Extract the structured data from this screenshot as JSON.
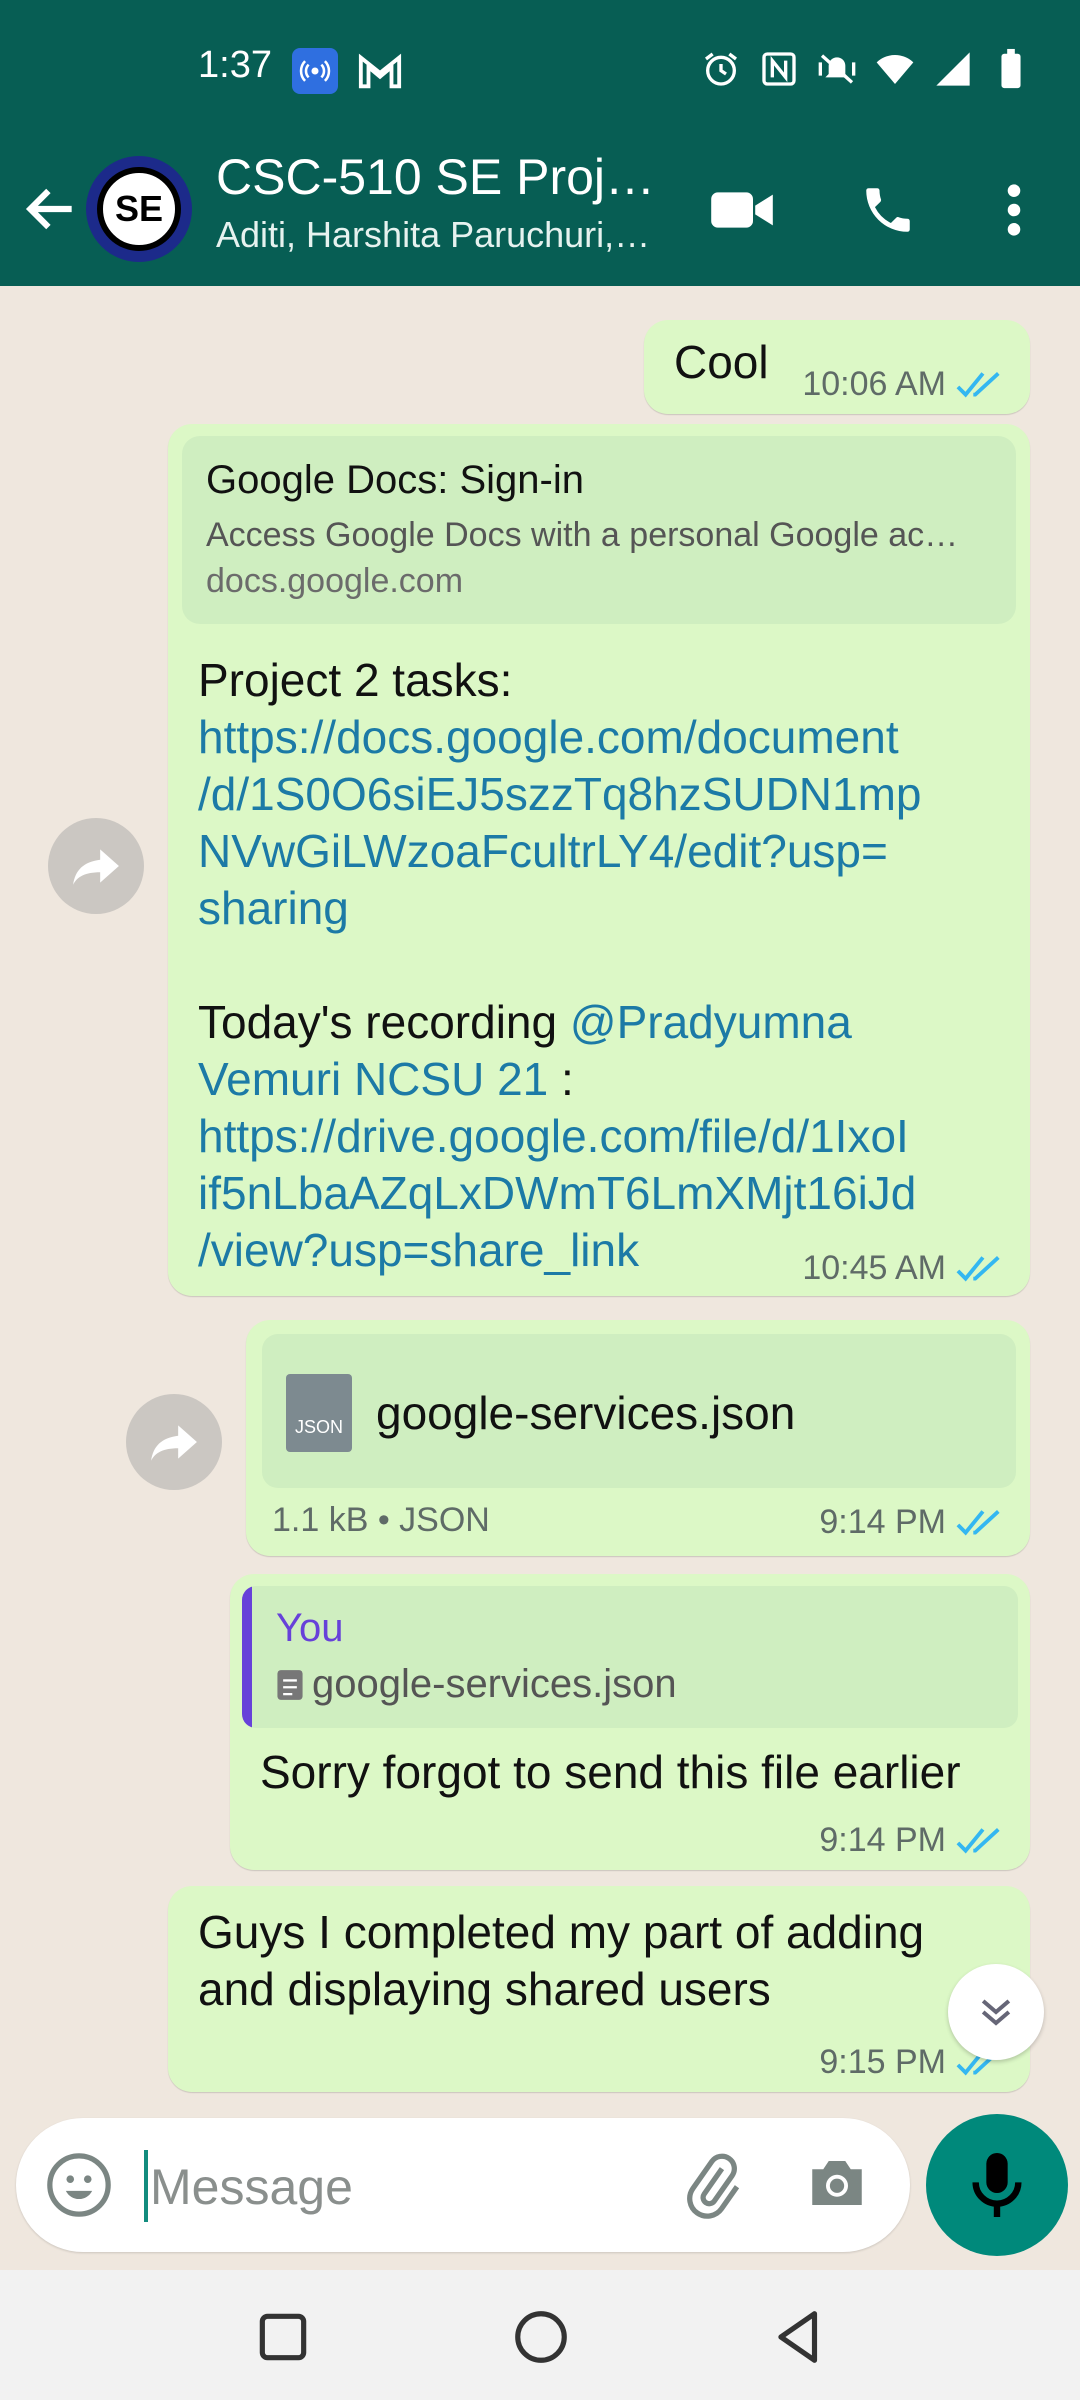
{
  "status_bar": {
    "time": "1:37",
    "icons": [
      "hotspot-icon",
      "gmail-icon",
      "alarm-icon",
      "nfc-icon",
      "vibrate-icon",
      "wifi-icon",
      "signal-icon",
      "battery-icon"
    ]
  },
  "header": {
    "avatar_text": "SE",
    "title": "CSC-510 SE Proj…",
    "subtitle": "Aditi, Harshita Paruchuri,…"
  },
  "messages": {
    "m1": {
      "text": "Cool",
      "time": "10:06 AM"
    },
    "m2": {
      "preview_title": "Google Docs: Sign-in",
      "preview_desc": "Access Google Docs with a personal Google ac…",
      "preview_domain": "docs.google.com",
      "line1": "Project 2 tasks:",
      "link1a": "https://docs.google.com/document",
      "link1b": "/d/1S0O6siEJ5szzTq8hzSUDN1mp",
      "link1c": "NVwGiLWzoaFcultrLY4/edit?usp=",
      "link1d": "sharing",
      "line2_prefix": "Today's recording ",
      "mention_a": "@Pradyumna",
      "mention_b": "Vemuri NCSU 21",
      "line2_suffix": " :",
      "link2a": "https://drive.google.com/file/d/1IxoI",
      "link2b": "if5nLbaAZqLxDWmT6LmXMjt16iJd",
      "link2c": "/view?usp=share_link",
      "time": "10:45 AM"
    },
    "m3": {
      "file_icon_label": "JSON",
      "filename": "google-services.json",
      "fileinfo": "1.1 kB • JSON",
      "time": "9:14 PM"
    },
    "m4": {
      "quote_name": "You",
      "quote_file": "google-services.json",
      "text": "Sorry forgot to send this file earlier",
      "time": "9:14 PM"
    },
    "m5": {
      "line1": "Guys I completed my part of adding",
      "line2": "and displaying shared users",
      "time": "9:15 PM"
    }
  },
  "composer": {
    "placeholder": "Message"
  },
  "colors": {
    "header": "#075e54",
    "bubble": "#dcf8c6",
    "link": "#1c7aa6",
    "read_ticks": "#34b7f1",
    "mic": "#00897b"
  }
}
